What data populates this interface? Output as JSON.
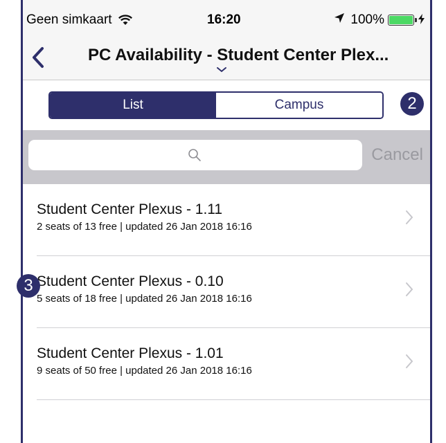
{
  "status_bar": {
    "carrier": "Geen simkaart",
    "time": "16:20",
    "battery": "100%",
    "battery_level": 1.0,
    "icons": [
      "wifi-icon",
      "location-arrow-icon",
      "battery-icon",
      "charging-bolt-icon"
    ]
  },
  "nav": {
    "title": "PC Availability - Student Center Plex...",
    "icons": [
      "chevron-left-icon",
      "chevron-down-icon"
    ]
  },
  "segment": {
    "list_label": "List",
    "campus_label": "Campus",
    "selected": "List"
  },
  "search": {
    "placeholder": "",
    "cancel_label": "Cancel",
    "icons": [
      "search-icon"
    ]
  },
  "locations": [
    {
      "title": "Student Center Plexus - 1.11",
      "subtitle": "2 seats of 13 free | updated 26 Jan 2018 16:16"
    },
    {
      "title": "Student Center Plexus - 0.10",
      "subtitle": "5 seats of 18 free | updated 26 Jan 2018 16:16"
    },
    {
      "title": "Student Center Plexus - 1.01",
      "subtitle": "9 seats of 50 free | updated 26 Jan 2018 16:16"
    }
  ],
  "callouts": {
    "first": "2",
    "second": "3"
  },
  "colors": {
    "accent": "#2e2f6b",
    "search_bar_bg": "#c8c7cc",
    "battery": "#4cd964"
  }
}
